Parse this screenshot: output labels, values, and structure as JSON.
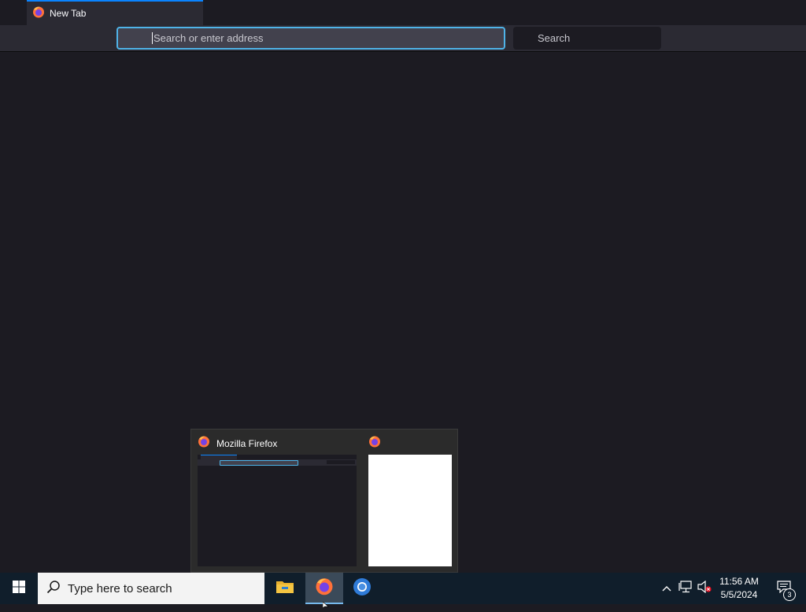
{
  "browser": {
    "tab": {
      "title": "New Tab"
    },
    "urlbar": {
      "placeholder": "Search or enter address"
    },
    "searchbar": {
      "placeholder": "Search"
    },
    "colors": {
      "accent": "#0a84ff",
      "focus_ring": "#4fb3e8",
      "toolbar": "#2b2a33",
      "background": "#1c1b22"
    }
  },
  "preview": {
    "windows": [
      {
        "title": "Mozilla Firefox",
        "icon": "firefox-icon"
      },
      {
        "title": "",
        "icon": "firefox-icon"
      }
    ]
  },
  "taskbar": {
    "search_placeholder": "Type here to search",
    "apps": [
      {
        "name": "File Explorer",
        "icon": "folder-icon"
      },
      {
        "name": "Mozilla Firefox",
        "icon": "firefox-icon",
        "active": true
      },
      {
        "name": "Chromium",
        "icon": "chromium-icon"
      }
    ],
    "tray": {
      "icons": [
        "chevron-up-icon",
        "network-icon",
        "volume-muted-icon"
      ],
      "time": "11:56 AM",
      "date": "5/5/2024",
      "notification_count": "3"
    }
  }
}
